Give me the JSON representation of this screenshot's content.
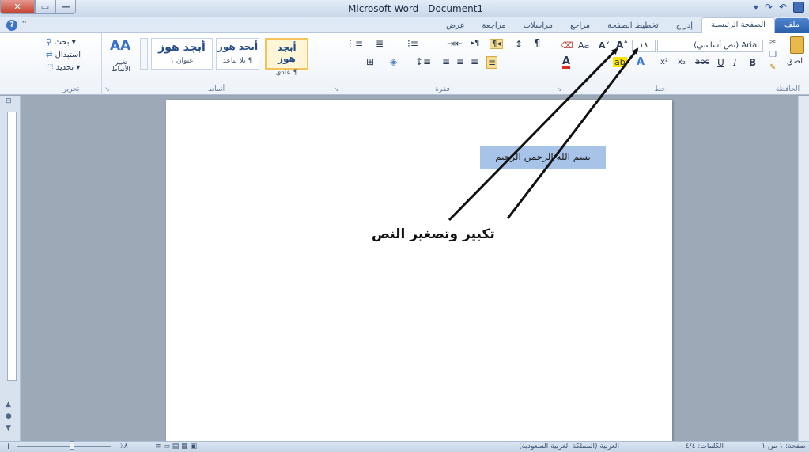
{
  "window": {
    "title": "Microsoft Word - Document1",
    "close_glyph": "✕",
    "maximize_glyph": "▭",
    "minimize_glyph": "—"
  },
  "qat": {
    "undo": "↶",
    "redo": "↷",
    "dropdown": "▾"
  },
  "help_glyph": "?",
  "minimize_ribbon_glyph": "⌃",
  "tabs": [
    "ملف",
    "الصفحة الرئيسية",
    "إدراج",
    "تخطيط الصفحة",
    "مراجع",
    "مراسلات",
    "مراجعة",
    "عرض"
  ],
  "ribbon": {
    "clipboard": {
      "label": "الحافظة",
      "paste": "لصق"
    },
    "font": {
      "label": "خط",
      "font_name": "Arial (نص أساسي)",
      "font_size": "١٨",
      "grow": "A˄",
      "shrink": "A˅",
      "change_case": "Aa",
      "clear": "⌫",
      "bold": "B",
      "italic": "I",
      "underline": "U",
      "strike": "abc",
      "subscript": "x₂",
      "superscript": "x²",
      "effects": "A",
      "highlight": "ab",
      "color": "A"
    },
    "paragraph": {
      "label": "فقرة",
      "show_marks": "¶",
      "sort": "↕",
      "rtl": "¶◂",
      "ltr": "▸¶",
      "lines": "≡"
    },
    "styles": {
      "label": "أنماط",
      "cards": [
        {
          "sample": "أبجد هوز",
          "name": "¶ عادي"
        },
        {
          "sample": "أبجد هوز",
          "name": "¶ بلا تباعد"
        },
        {
          "sample": "أبجد هوز",
          "name": "عنوان ١"
        }
      ],
      "change": "تغيير الأنماط",
      "icon": "AA"
    },
    "editing": {
      "label": "تحرير",
      "find": "بحث",
      "replace": "استبدال",
      "select": "تحديد"
    }
  },
  "document": {
    "selected_text": "بسم الله الرحمن الرحيم"
  },
  "annotation": "تكبير وتصغير النص",
  "status": {
    "page": "صفحة: ١ من ١",
    "words": "الكلمات: ٤/٤",
    "language": "العربية (المملكة العربية السعودية)",
    "zoom": "٪٨٠",
    "zoom_out": "−",
    "zoom_in": "+"
  }
}
